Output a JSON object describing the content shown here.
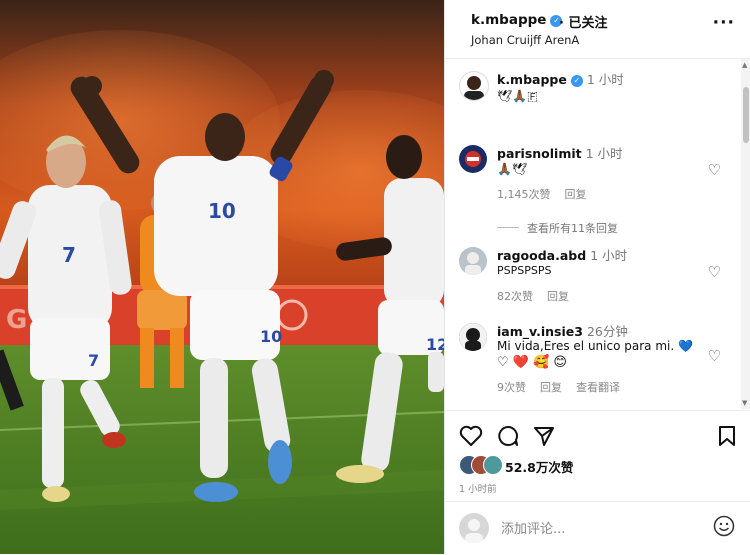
{
  "header": {
    "username": "k.mbappe",
    "follow_label": "· 已关注",
    "location": "Johan Cruijff ArenA",
    "more_label": "···"
  },
  "caption": {
    "username": "k.mbappe",
    "time": "1 小时",
    "text": "🕊🙏🏾🇫"
  },
  "comments": [
    {
      "username": "parisnolimit",
      "time": "1 小时",
      "text": "🙏🏾🕊",
      "likes": "1,145次赞",
      "reply": "回复"
    },
    {
      "username": "ragooda.abd",
      "time": "1 小时",
      "text": "PSPSPSPS",
      "likes": "82次赞",
      "reply": "回复"
    },
    {
      "username": "iam_v.insie3",
      "time": "26分钟",
      "text": "Mi vida,Eres el unico para mi. 💙",
      "emojis": "♡ ❤️ 🥰 😊",
      "likes": "9次赞",
      "reply": "回复",
      "translate": "查看翻译"
    }
  ],
  "view_replies": "查看所有11条回复",
  "actions": {
    "likes_label": "52.8万次赞",
    "time_ago": "1 小时前",
    "icons": [
      "heart-icon",
      "comment-icon",
      "share-icon",
      "bookmark-icon"
    ]
  },
  "composer": {
    "placeholder": "添加评论..."
  },
  "photo": {
    "jersey_numbers": [
      "10",
      "7",
      "7",
      "10",
      "12"
    ]
  },
  "colors": {
    "verified": "#3897f0",
    "heart_red": "#e0245e",
    "heart_blue": "#2b6fd6"
  }
}
